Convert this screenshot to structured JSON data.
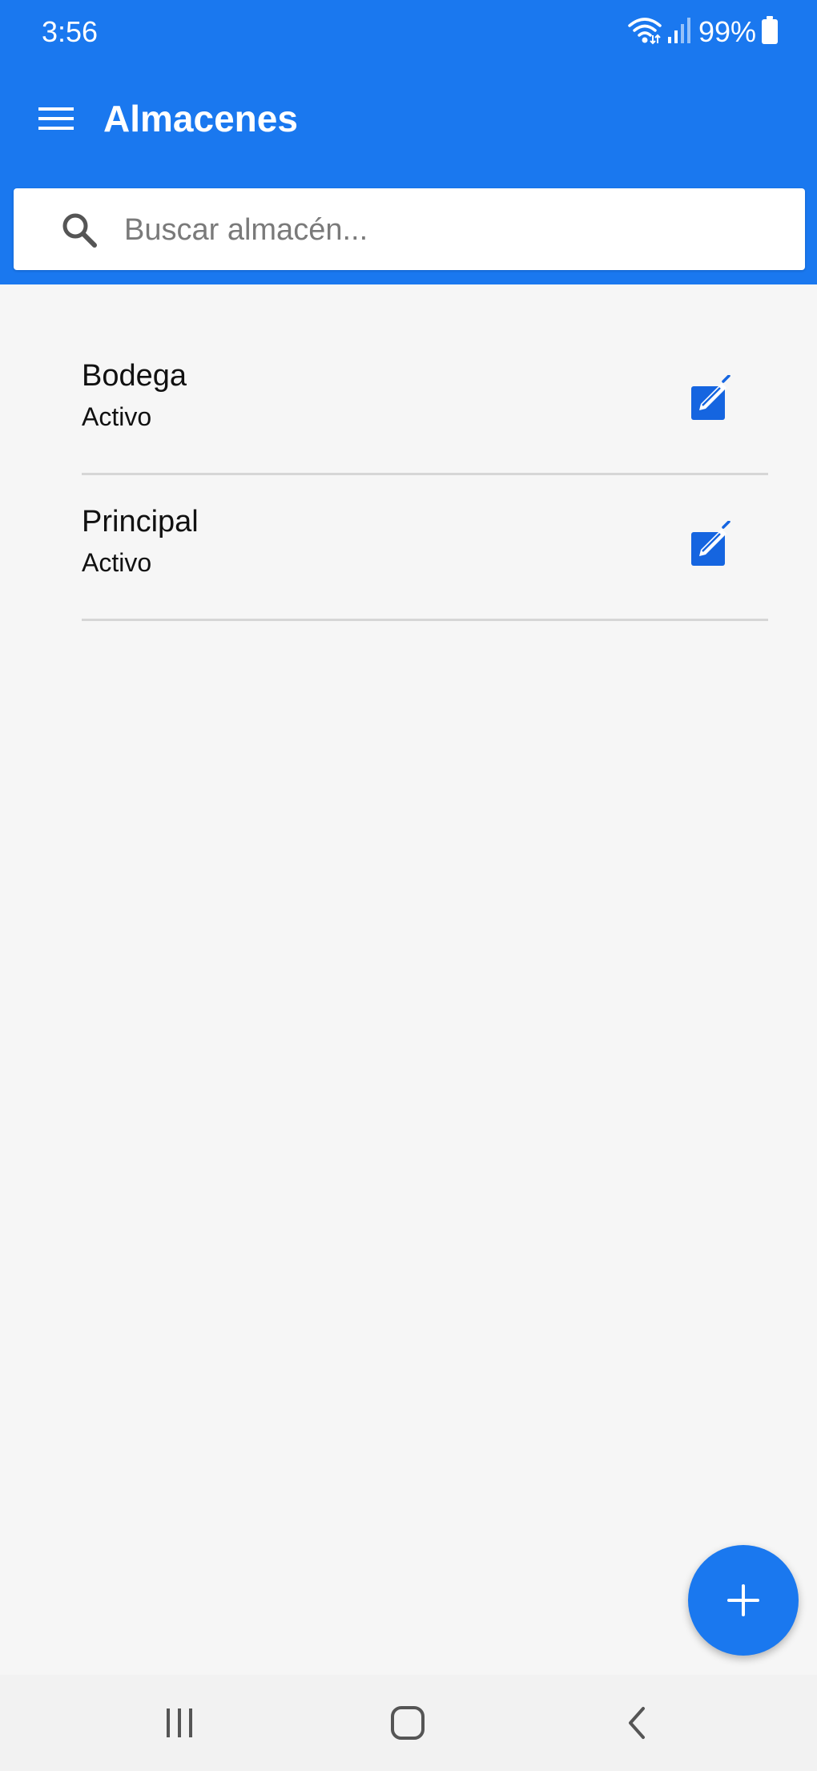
{
  "status_bar": {
    "time": "3:56",
    "battery_percent": "99%",
    "icons": [
      "wifi-icon",
      "signal-icon",
      "battery-icon"
    ]
  },
  "toolbar": {
    "title": "Almacenes",
    "menu_icon": "hamburger-menu-icon"
  },
  "search": {
    "placeholder": "Buscar almacén...",
    "value": "",
    "icon": "search-icon"
  },
  "warehouses": [
    {
      "name": "Bodega",
      "status": "Activo",
      "action_icon": "edit-icon"
    },
    {
      "name": "Principal",
      "status": "Activo",
      "action_icon": "edit-icon"
    }
  ],
  "fab": {
    "icon": "plus-icon"
  },
  "nav_bar": {
    "buttons": [
      "recent-apps-icon",
      "home-icon",
      "back-icon"
    ]
  },
  "colors": {
    "primary": "#1a78ef",
    "edit_icon": "#1565e0",
    "background": "#f6f6f6",
    "divider": "#d6d6d6"
  }
}
